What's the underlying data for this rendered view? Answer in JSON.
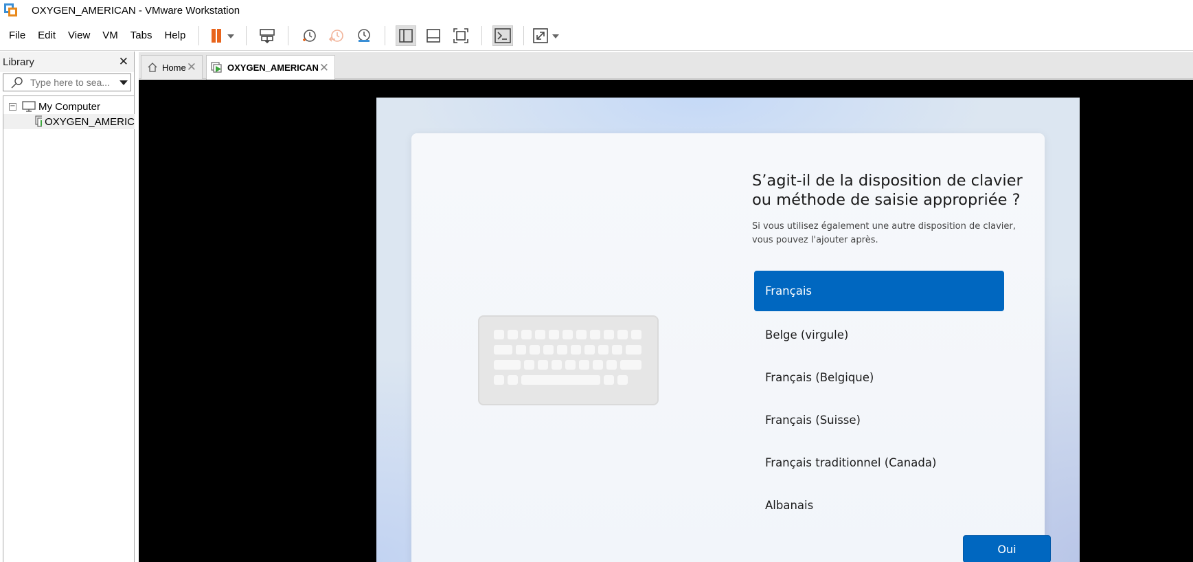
{
  "window": {
    "title": "OXYGEN_AMERICAN - VMware Workstation"
  },
  "menu": {
    "items": [
      {
        "id": "file",
        "label": "File"
      },
      {
        "id": "edit",
        "label": "Edit"
      },
      {
        "id": "view",
        "label": "View"
      },
      {
        "id": "vm",
        "label": "VM"
      },
      {
        "id": "tabs",
        "label": "Tabs"
      },
      {
        "id": "help",
        "label": "Help"
      }
    ]
  },
  "toolbar": {
    "buttons": [
      "pause-icon",
      "send-ctrl-alt-del-icon",
      "snapshot-take-icon",
      "snapshot-revert-icon",
      "snapshot-manager-icon",
      "show-library-icon",
      "show-thumbnail-bar-icon",
      "full-screen-icon",
      "console-view-icon",
      "stretch-guest-icon"
    ],
    "accent_pause": "#e8641c"
  },
  "library": {
    "title": "Library",
    "close_glyph": "✕",
    "search_placeholder": "Type here to sea...",
    "tree": {
      "root_label": "My Computer",
      "expander": "⊟",
      "child_label": "OXYGEN_AMERIC"
    }
  },
  "tabs": {
    "home_label": "Home",
    "vm_label": "OXYGEN_AMERICAN",
    "close_glyph": "✕"
  },
  "guest": {
    "heading_line1": "S’agit-il de la disposition de clavier",
    "heading_line2": "ou méthode de saisie appropriée ?",
    "subtext_line1": "Si vous utilisez également une autre disposition de clavier,",
    "subtext_line2": "vous pouvez l'ajouter après.",
    "keyboard_options": [
      {
        "label": "Français",
        "selected": true
      },
      {
        "label": "Belge (virgule)",
        "selected": false
      },
      {
        "label": "Français (Belgique)",
        "selected": false
      },
      {
        "label": "Français (Suisse)",
        "selected": false
      },
      {
        "label": "Français traditionnel (Canada)",
        "selected": false
      },
      {
        "label": "Albanais",
        "selected": false
      }
    ],
    "confirm_label": "Oui",
    "accent": "#0067c0"
  }
}
